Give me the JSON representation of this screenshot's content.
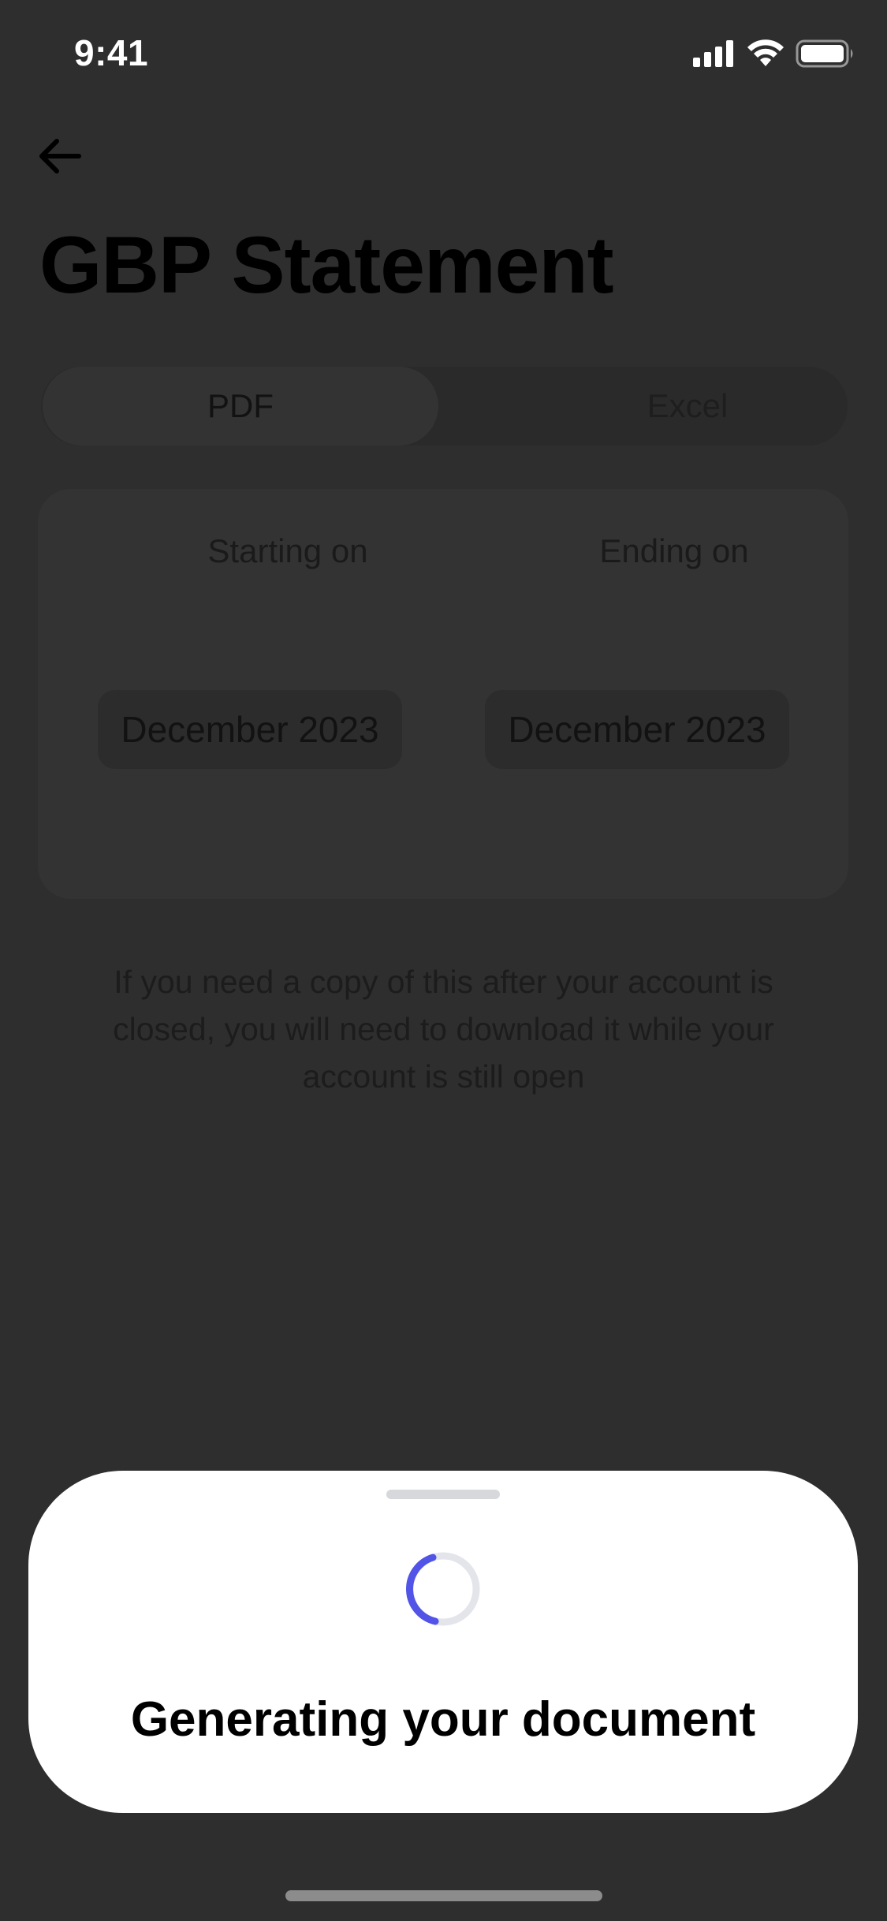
{
  "status_bar": {
    "time": "9:41",
    "icons": [
      "cellular-signal-icon",
      "wifi-icon",
      "battery-icon"
    ]
  },
  "header": {
    "back_icon": "back-arrow-icon",
    "title": "GBP Statement"
  },
  "format_toggle": {
    "options": [
      {
        "label": "PDF",
        "selected": true
      },
      {
        "label": "Excel",
        "selected": false
      }
    ]
  },
  "date_range": {
    "start_label": "Starting on",
    "start_value": "December 2023",
    "end_label": "Ending on",
    "end_value": "December 2023"
  },
  "info_text": "If you need a copy of this after your account is closed, you will need to download it while your account is still open",
  "bottom_sheet": {
    "title": "Generating your document",
    "spinner_icon": "loading-spinner-icon"
  },
  "colors": {
    "overlay_background": "#2e2e2e",
    "sheet_background": "#ffffff",
    "spinner_accent": "#5154e6",
    "spinner_track": "#e3e5ea"
  }
}
